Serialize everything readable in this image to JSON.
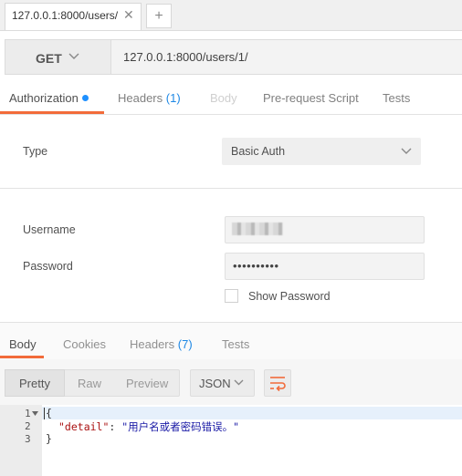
{
  "tabs": {
    "request_tab_title": "127.0.0.1:8000/users/",
    "close_glyph": "✕",
    "new_tab_glyph": "+"
  },
  "request": {
    "method": "GET",
    "url": "127.0.0.1:8000/users/1/"
  },
  "request_tabs": [
    {
      "label": "Authorization"
    },
    {
      "label": "Headers",
      "count": "(1)"
    },
    {
      "label": "Body"
    },
    {
      "label": "Pre-request Script"
    },
    {
      "label": "Tests"
    }
  ],
  "auth": {
    "type_label": "Type",
    "type_value": "Basic Auth",
    "username_label": "Username",
    "password_label": "Password",
    "password_value": "••••••••••",
    "show_password_label": "Show Password"
  },
  "response_tabs": [
    {
      "label": "Body"
    },
    {
      "label": "Cookies"
    },
    {
      "label": "Headers",
      "count": "(7)"
    },
    {
      "label": "Tests"
    }
  ],
  "response_toolbar": {
    "pretty": "Pretty",
    "raw": "Raw",
    "preview": "Preview",
    "language": "JSON"
  },
  "code": {
    "line_numbers": [
      "1",
      "2",
      "3"
    ],
    "open_brace": "{",
    "key": "\"detail\"",
    "colon": ": ",
    "value": "\"用户名或者密码错误。\"",
    "close_brace": "}"
  },
  "colors": {
    "accent": "#f26b3a",
    "active_dot": "#1e90ff",
    "count": "#1e88e5"
  }
}
